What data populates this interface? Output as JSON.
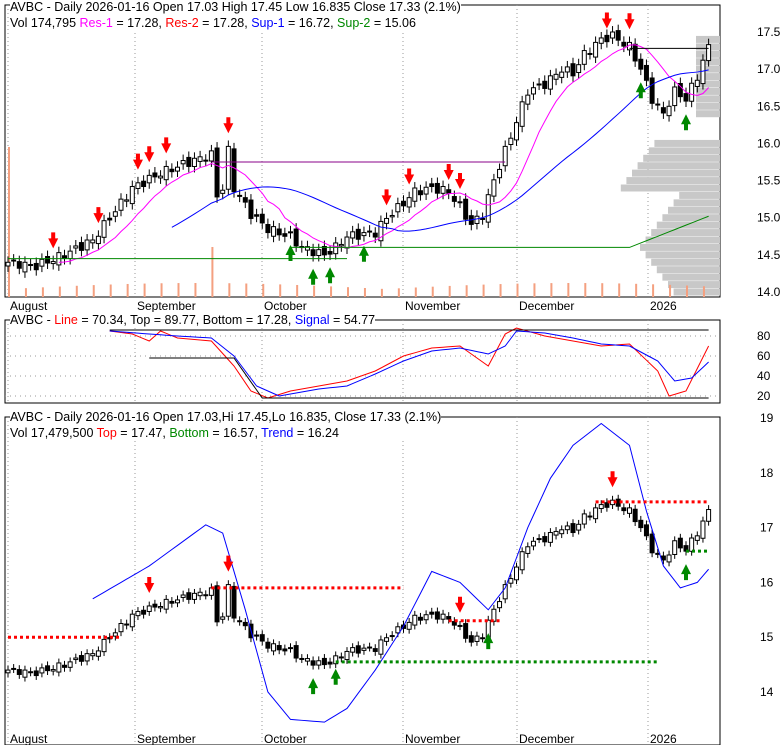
{
  "chart_data": [
    {
      "type": "candlestick",
      "title": "AVBC - Daily 2026-01-16",
      "open": "17.03",
      "high": "17.45",
      "low": "16.835",
      "close": "17.33",
      "change": "(2.1%)",
      "vol": "174,795",
      "res1": "17.28",
      "res2": "17.28",
      "sup1": "16.72",
      "sup2": "15.06",
      "labels": {
        "title": "AVBC - Daily 2026-01-16 Open 17.03  High 17.45  Low 16.835  Close 17.33 (2.1%)",
        "vol": "Vol 174,795",
        "res1": "Res-1",
        "res2": "Res-2",
        "sup1": "Sup-1",
        "sup2": "Sup-2",
        "res1v": " = 17.28, ",
        "res2v": " = 17.28, ",
        "sup1v": " = 16.72, ",
        "sup2v": " = 15.06"
      },
      "ylim": [
        14,
        17.5
      ],
      "yticks": [
        "17.5",
        "17.0",
        "16.5",
        "16.0",
        "15.5",
        "15.0",
        "14.5",
        "14.0"
      ],
      "xticks": [
        "August",
        "September",
        "October",
        "November",
        "December",
        "2026"
      ],
      "close_keypoints": [
        [
          0,
          14.4
        ],
        [
          5,
          14.35
        ],
        [
          10,
          14.5
        ],
        [
          15,
          14.7
        ],
        [
          17,
          14.9
        ],
        [
          22,
          15.4
        ],
        [
          27,
          15.6
        ],
        [
          32,
          15.75
        ],
        [
          36,
          15.85
        ],
        [
          37,
          15.3
        ],
        [
          38,
          15.4
        ],
        [
          39,
          15.9
        ],
        [
          40,
          15.4
        ],
        [
          43,
          15.05
        ],
        [
          46,
          14.85
        ],
        [
          50,
          14.75
        ],
        [
          52,
          14.6
        ],
        [
          56,
          14.5
        ],
        [
          58,
          14.6
        ],
        [
          60,
          14.75
        ],
        [
          65,
          14.8
        ],
        [
          67,
          15.0
        ],
        [
          70,
          15.2
        ],
        [
          72,
          15.35
        ],
        [
          75,
          15.4
        ],
        [
          78,
          15.35
        ],
        [
          80,
          15.15
        ],
        [
          82,
          14.9
        ],
        [
          84,
          15.05
        ],
        [
          86,
          15.5
        ],
        [
          88,
          15.9
        ],
        [
          90,
          16.3
        ],
        [
          92,
          16.7
        ],
        [
          95,
          16.8
        ],
        [
          98,
          17.0
        ],
        [
          100,
          16.95
        ],
        [
          102,
          17.2
        ],
        [
          105,
          17.4
        ],
        [
          107,
          17.45
        ],
        [
          110,
          17.3
        ],
        [
          112,
          17.0
        ],
        [
          114,
          16.6
        ],
        [
          116,
          16.4
        ],
        [
          118,
          16.7
        ],
        [
          120,
          16.6
        ],
        [
          122,
          16.9
        ],
        [
          124,
          17.33
        ]
      ],
      "sell_signals": [
        8,
        16,
        23,
        25,
        28,
        39,
        67,
        71,
        78,
        80,
        106,
        110
      ],
      "buy_signals": [
        50,
        54,
        57,
        63,
        112,
        120
      ]
    },
    {
      "type": "line",
      "title": "AVBC",
      "labels": {
        "pre": "AVBC - ",
        "line": "Line",
        "linev": " = 70.34, Top = 89.77, Bottom = 17.28, ",
        "signal": "Signal",
        "signalv": " = 54.77"
      },
      "ylim": [
        10,
        95
      ],
      "yticks": [
        "80",
        "60",
        "40",
        "20"
      ],
      "line": [
        [
          18,
          85
        ],
        [
          22,
          82
        ],
        [
          25,
          75
        ],
        [
          27,
          85
        ],
        [
          30,
          78
        ],
        [
          36,
          75
        ],
        [
          40,
          50
        ],
        [
          43,
          25
        ],
        [
          46,
          18
        ],
        [
          50,
          25
        ],
        [
          55,
          30
        ],
        [
          60,
          35
        ],
        [
          65,
          45
        ],
        [
          70,
          60
        ],
        [
          75,
          68
        ],
        [
          80,
          70
        ],
        [
          85,
          50
        ],
        [
          88,
          82
        ],
        [
          90,
          88
        ],
        [
          95,
          80
        ],
        [
          100,
          75
        ],
        [
          105,
          70
        ],
        [
          110,
          72
        ],
        [
          115,
          45
        ],
        [
          117,
          20
        ],
        [
          120,
          25
        ],
        [
          124,
          70
        ]
      ],
      "signal": [
        [
          18,
          85
        ],
        [
          25,
          82
        ],
        [
          30,
          80
        ],
        [
          36,
          78
        ],
        [
          40,
          60
        ],
        [
          44,
          30
        ],
        [
          48,
          20
        ],
        [
          55,
          27
        ],
        [
          60,
          30
        ],
        [
          65,
          42
        ],
        [
          70,
          55
        ],
        [
          75,
          65
        ],
        [
          80,
          68
        ],
        [
          85,
          62
        ],
        [
          88,
          70
        ],
        [
          90,
          85
        ],
        [
          95,
          83
        ],
        [
          100,
          78
        ],
        [
          105,
          72
        ],
        [
          110,
          70
        ],
        [
          115,
          55
        ],
        [
          118,
          35
        ],
        [
          121,
          38
        ],
        [
          124,
          54
        ]
      ]
    },
    {
      "type": "candlestick",
      "title": "AVBC - Daily 2026-01-16",
      "labels": {
        "title": "AVBC - Daily 2026-01-16 Open 17.03,Hi 17.45,Lo 16.835, Close 17.33 (2.1%)",
        "vol": "Vol 17,479,500 ",
        "top": "Top",
        "topv": " = 17.47, ",
        "bottom": "Bottom",
        "bottomv": " = 16.57, ",
        "trend": "Trend",
        "trendv": " = 16.24"
      },
      "ylim": [
        13.4,
        19
      ],
      "yticks": [
        "19",
        "18",
        "17",
        "16",
        "15",
        "14"
      ],
      "trend": [
        [
          15,
          15.7
        ],
        [
          25,
          16.3
        ],
        [
          35,
          17.05
        ],
        [
          38,
          16.9
        ],
        [
          42,
          15.5
        ],
        [
          46,
          14.0
        ],
        [
          50,
          13.5
        ],
        [
          56,
          13.45
        ],
        [
          60,
          13.7
        ],
        [
          65,
          14.4
        ],
        [
          70,
          15.2
        ],
        [
          75,
          16.2
        ],
        [
          80,
          16.0
        ],
        [
          85,
          15.5
        ],
        [
          88,
          15.9
        ],
        [
          92,
          17.0
        ],
        [
          96,
          17.9
        ],
        [
          100,
          18.5
        ],
        [
          105,
          18.9
        ],
        [
          110,
          18.5
        ],
        [
          113,
          17.3
        ],
        [
          116,
          16.3
        ],
        [
          119,
          15.9
        ],
        [
          122,
          16.0
        ],
        [
          124,
          16.24
        ]
      ]
    }
  ]
}
